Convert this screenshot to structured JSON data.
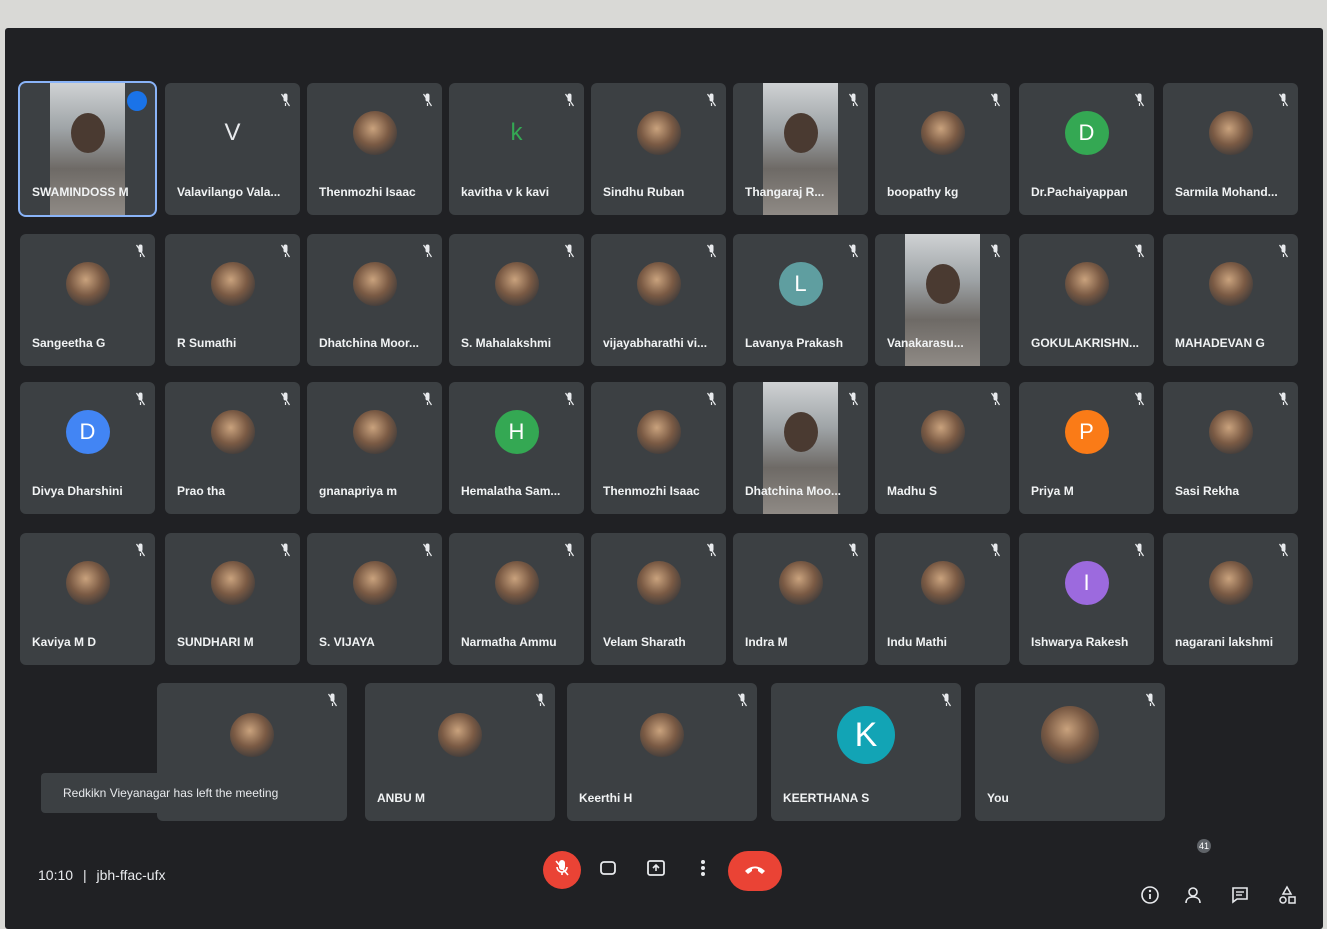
{
  "participants": [
    {
      "name": "SWAMINDOSS M",
      "avatar": "video",
      "active": true
    },
    {
      "name": "Valavilango Vala...",
      "avatar": "letter",
      "letter": "V",
      "plain": true
    },
    {
      "name": "Thenmozhi Isaac",
      "avatar": "photo"
    },
    {
      "name": "kavitha v k kavi",
      "avatar": "letter",
      "letter": "k",
      "plain": true,
      "color": "#34a853"
    },
    {
      "name": "Sindhu Ruban",
      "avatar": "photo"
    },
    {
      "name": "Thangaraj R...",
      "avatar": "video"
    },
    {
      "name": "boopathy kg",
      "avatar": "photo"
    },
    {
      "name": "Dr.Pachaiyappan",
      "avatar": "letter",
      "letter": "D",
      "color": "#34a853"
    },
    {
      "name": "Sarmila Mohand...",
      "avatar": "photo"
    },
    {
      "name": "Sangeetha G",
      "avatar": "photo"
    },
    {
      "name": "R Sumathi",
      "avatar": "photo"
    },
    {
      "name": "Dhatchina Moor...",
      "avatar": "photo"
    },
    {
      "name": "S. Mahalakshmi",
      "avatar": "photo"
    },
    {
      "name": "vijayabharathi vi...",
      "avatar": "photo"
    },
    {
      "name": "Lavanya Prakash",
      "avatar": "letter",
      "letter": "L",
      "color": "#5f9ea0"
    },
    {
      "name": "Vanakarasu...",
      "avatar": "video"
    },
    {
      "name": "GOKULAKRISHN...",
      "avatar": "photo"
    },
    {
      "name": "MAHADEVAN G",
      "avatar": "photo"
    },
    {
      "name": "Divya Dharshini",
      "avatar": "letter",
      "letter": "D",
      "color": "#4285f4"
    },
    {
      "name": "Prao tha",
      "avatar": "photo"
    },
    {
      "name": "gnanapriya m",
      "avatar": "photo"
    },
    {
      "name": "Hemalatha Sam...",
      "avatar": "letter",
      "letter": "H",
      "color": "#34a853"
    },
    {
      "name": "Thenmozhi Isaac",
      "avatar": "photo"
    },
    {
      "name": "Dhatchina Moo...",
      "avatar": "video"
    },
    {
      "name": "Madhu S",
      "avatar": "photo"
    },
    {
      "name": "Priya M",
      "avatar": "letter",
      "letter": "P",
      "color": "#fa7b17"
    },
    {
      "name": "Sasi Rekha",
      "avatar": "photo"
    },
    {
      "name": "Kaviya M D",
      "avatar": "photo"
    },
    {
      "name": "SUNDHARI M",
      "avatar": "photo"
    },
    {
      "name": "S. VIJAYA",
      "avatar": "photo"
    },
    {
      "name": "Narmatha Ammu",
      "avatar": "photo"
    },
    {
      "name": "Velam Sharath",
      "avatar": "photo"
    },
    {
      "name": "Indra M",
      "avatar": "photo"
    },
    {
      "name": "Indu Mathi",
      "avatar": "photo"
    },
    {
      "name": "Ishwarya Rakesh",
      "avatar": "letter",
      "letter": "I",
      "color": "#9c6ade"
    },
    {
      "name": "nagarani lakshmi",
      "avatar": "photo"
    },
    {
      "name": "",
      "avatar": "photo"
    },
    {
      "name": "ANBU M",
      "avatar": "photo"
    },
    {
      "name": "Keerthi H",
      "avatar": "photo"
    },
    {
      "name": "KEERTHANA S",
      "avatar": "letter",
      "letter": "K",
      "color": "#12a4b5",
      "big": true
    },
    {
      "name": "You",
      "avatar": "photo",
      "big": true
    }
  ],
  "toast": {
    "text": "Redkikn Vieyanagar has left the meeting"
  },
  "footer": {
    "time": "10:10",
    "separator": "|",
    "meeting_code": "jbh-ffac-ufx",
    "participant_count": "41"
  },
  "icons": {
    "mic_off": "mic-off-icon",
    "camera": "camera-icon",
    "present": "present-icon",
    "more": "more-vert-icon",
    "end_call": "call-end-icon",
    "info": "info-icon",
    "people": "people-icon",
    "chat": "chat-icon",
    "activities": "activities-icon"
  },
  "colors": {
    "background": "#202124",
    "tile": "#3c4043",
    "danger": "#ea4335",
    "active_outline": "#8ab4f8"
  }
}
